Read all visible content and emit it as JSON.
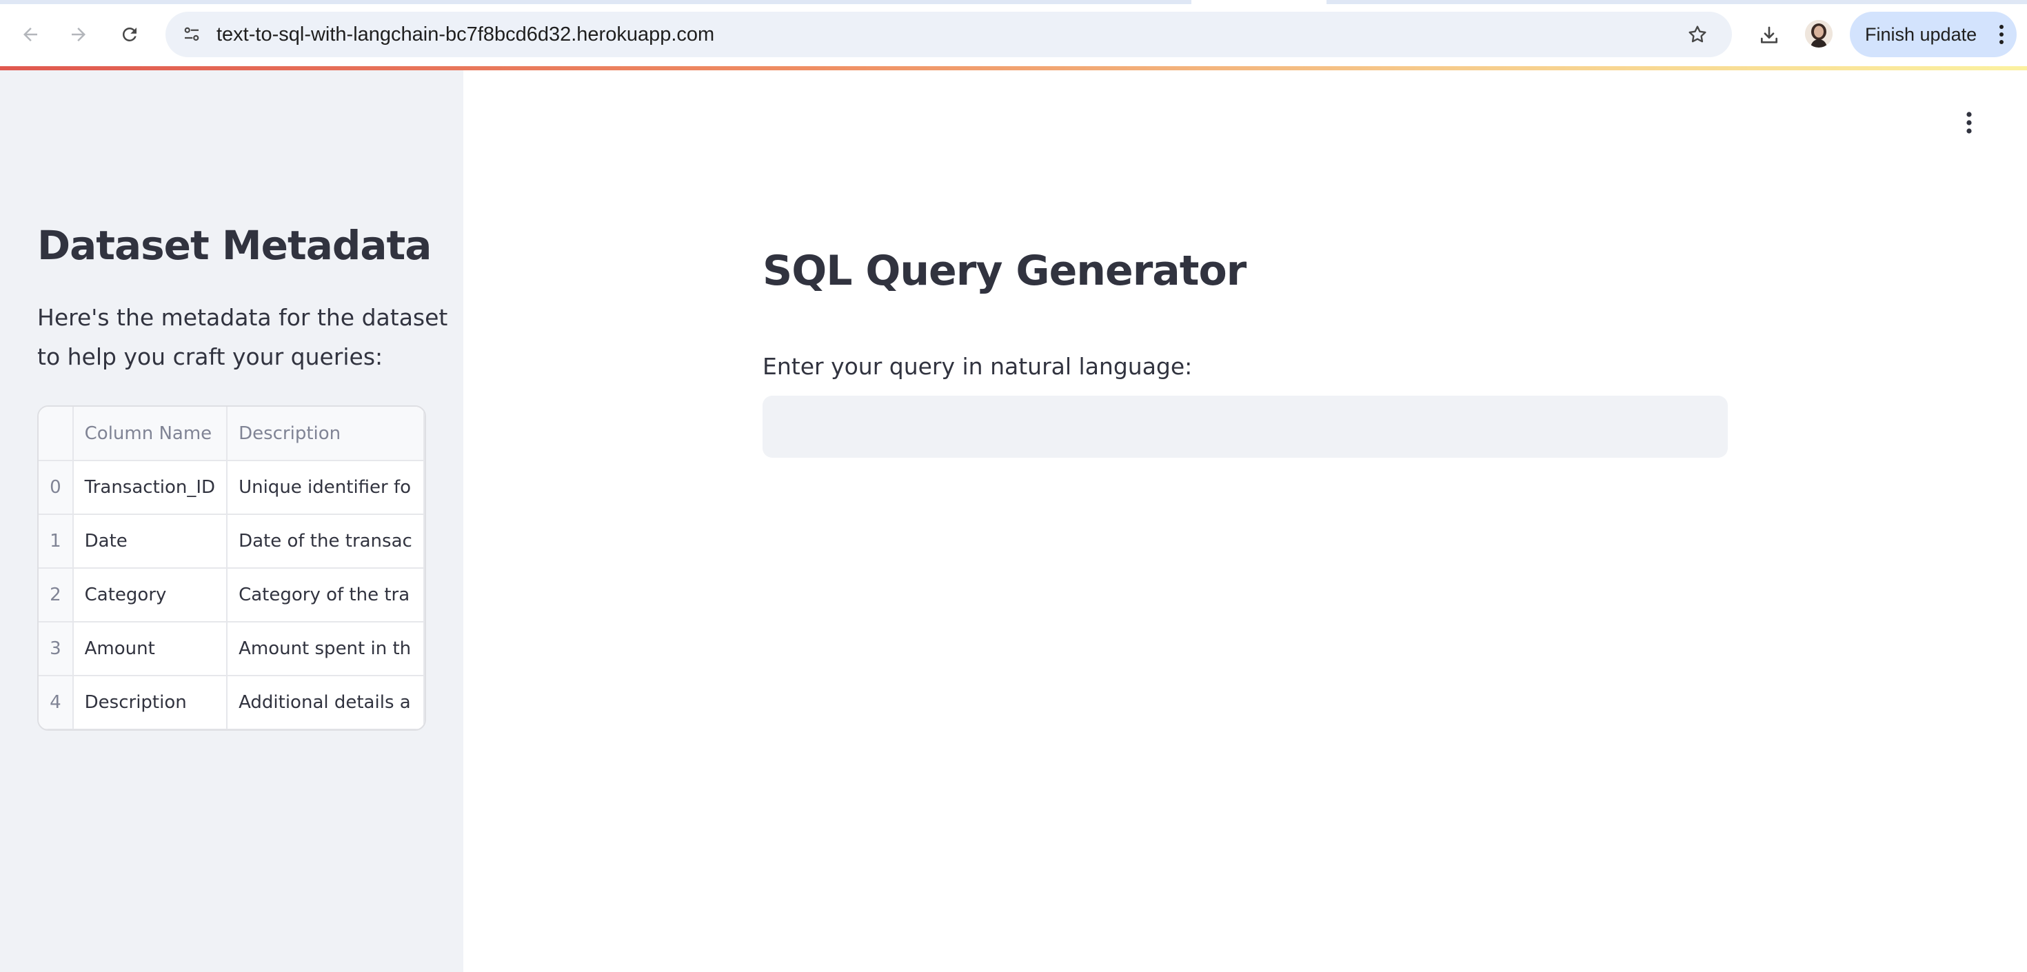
{
  "browser": {
    "url": "text-to-sql-with-langchain-bc7f8bcd6d32.herokuapp.com",
    "finish_update_label": "Finish update"
  },
  "sidebar": {
    "title": "Dataset Metadata",
    "description": "Here's the metadata for the dataset to help you craft your queries:",
    "table": {
      "headers": [
        "",
        "Column Name",
        "Description"
      ],
      "rows": [
        {
          "index": "0",
          "column_name": "Transaction_ID",
          "description": "Unique identifier fo"
        },
        {
          "index": "1",
          "column_name": "Date",
          "description": "Date of the transac"
        },
        {
          "index": "2",
          "column_name": "Category",
          "description": "Category of the tra"
        },
        {
          "index": "3",
          "column_name": "Amount",
          "description": "Amount spent in th"
        },
        {
          "index": "4",
          "column_name": "Description",
          "description": "Additional details a"
        }
      ]
    }
  },
  "main": {
    "title": "SQL Query Generator",
    "input_label": "Enter your query in natural language:",
    "input_value": ""
  },
  "colors": {
    "text": "#31333f",
    "sidebar_bg": "#f0f2f6",
    "finish_update_bg": "#d3e3fd"
  }
}
